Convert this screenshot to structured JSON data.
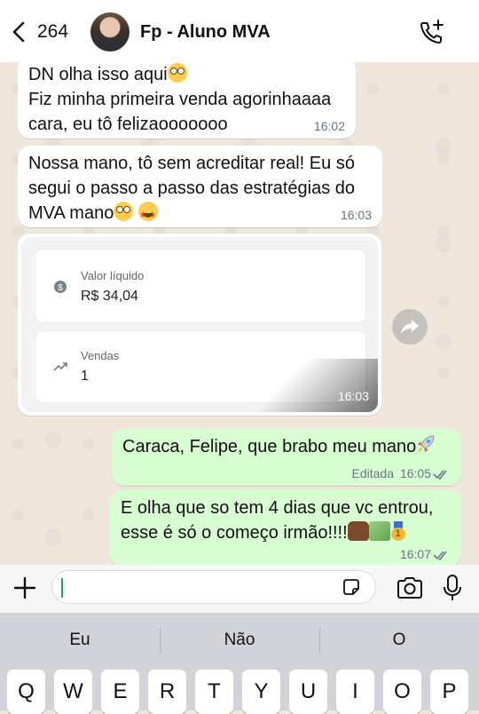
{
  "header": {
    "back_count": "264",
    "contact_name": "Fp - Aluno MVA"
  },
  "messages": {
    "m1": {
      "line1": "DN olha isso aqui",
      "line2": "Fiz minha primeira venda agorinhaaaa",
      "line3": "cara, eu tô felizaooooooo",
      "time": "16:02"
    },
    "m2": {
      "line1": "Nossa mano, tô sem acreditar real! Eu só",
      "line2": "segui o passo a passo das estratégias do",
      "line3": "MVA mano",
      "time": "16:03"
    },
    "m3": {
      "card1_label": "Valor líquido",
      "card1_value": "R$ 34,04",
      "card2_label": "Vendas",
      "card2_value": "1",
      "time": "16:03"
    },
    "m4": {
      "text": "Caraca, Felipe, que brabo meu mano",
      "edited": "Editada",
      "time": "16:05"
    },
    "m5": {
      "line1": "E olha que so tem 4 dias que vc entrou,",
      "line2": "esse é só o começo irmão!!!!",
      "time": "16:07"
    }
  },
  "keyboard": {
    "suggestions": [
      "Eu",
      "Não",
      "O"
    ],
    "keys": [
      "Q",
      "W",
      "E",
      "R",
      "T",
      "Y",
      "U",
      "I",
      "O",
      "P"
    ]
  },
  "colors": {
    "outgoing_bubble": "#d9fdd3",
    "incoming_bubble": "#ffffff",
    "chat_background": "#efe7dc",
    "accent_green": "#25a244"
  },
  "icons": [
    "back-icon",
    "avatar",
    "call-add-icon",
    "money-icon",
    "trend-icon",
    "forward-icon",
    "double-check-icon",
    "plus-icon",
    "sticker-icon",
    "camera-icon",
    "mic-icon"
  ]
}
